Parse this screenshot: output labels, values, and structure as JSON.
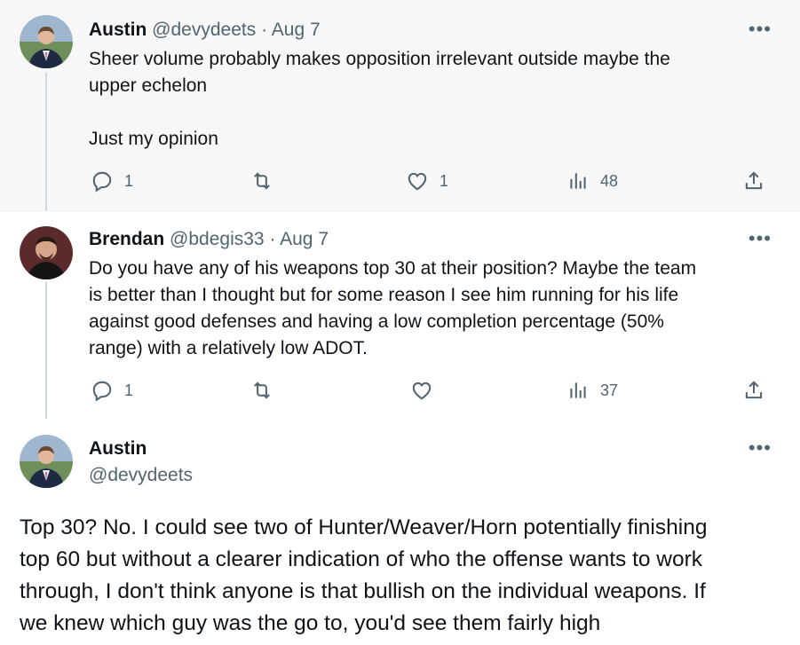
{
  "tweets": [
    {
      "author": "Austin",
      "handle": "@devydeets",
      "separator": "·",
      "date": "Aug 7",
      "text_lines": [
        "Sheer volume probably makes opposition irrelevant outside maybe the",
        "upper echelon",
        "",
        "Just my opinion"
      ],
      "replies": "1",
      "reposts": "",
      "likes": "1",
      "views": "48",
      "more": "•••"
    },
    {
      "author": "Brendan",
      "handle": "@bdegis33",
      "separator": "·",
      "date": "Aug 7",
      "text_lines": [
        "Do you have any of his weapons top 30 at their position? Maybe the team",
        "is better than I thought but for some reason I see him running for his life",
        "against good defenses and having a low completion percentage (50%",
        "range) with a relatively low ADOT."
      ],
      "replies": "1",
      "reposts": "",
      "likes": "",
      "views": "37",
      "more": "•••"
    },
    {
      "author": "Austin",
      "handle": "@devydeets",
      "text_lines": [
        "Top 30? No. I could see two of Hunter/Weaver/Horn potentially finishing",
        "top 60 but without a clearer indication of who the offense wants to work",
        "through, I don't think anyone is that bullish on the individual weapons. If",
        "we knew which guy was the go to, you'd see them fairly high"
      ],
      "more": "•••"
    }
  ],
  "icons": {
    "reply": "reply-icon",
    "repost": "repost-icon",
    "like": "heart-icon",
    "views": "analytics-icon",
    "share": "share-icon",
    "more": "more-icon"
  },
  "colors": {
    "highlight_bg": "#f7f7f7",
    "thread_line": "#cfd9de",
    "secondary_text": "#536471"
  }
}
